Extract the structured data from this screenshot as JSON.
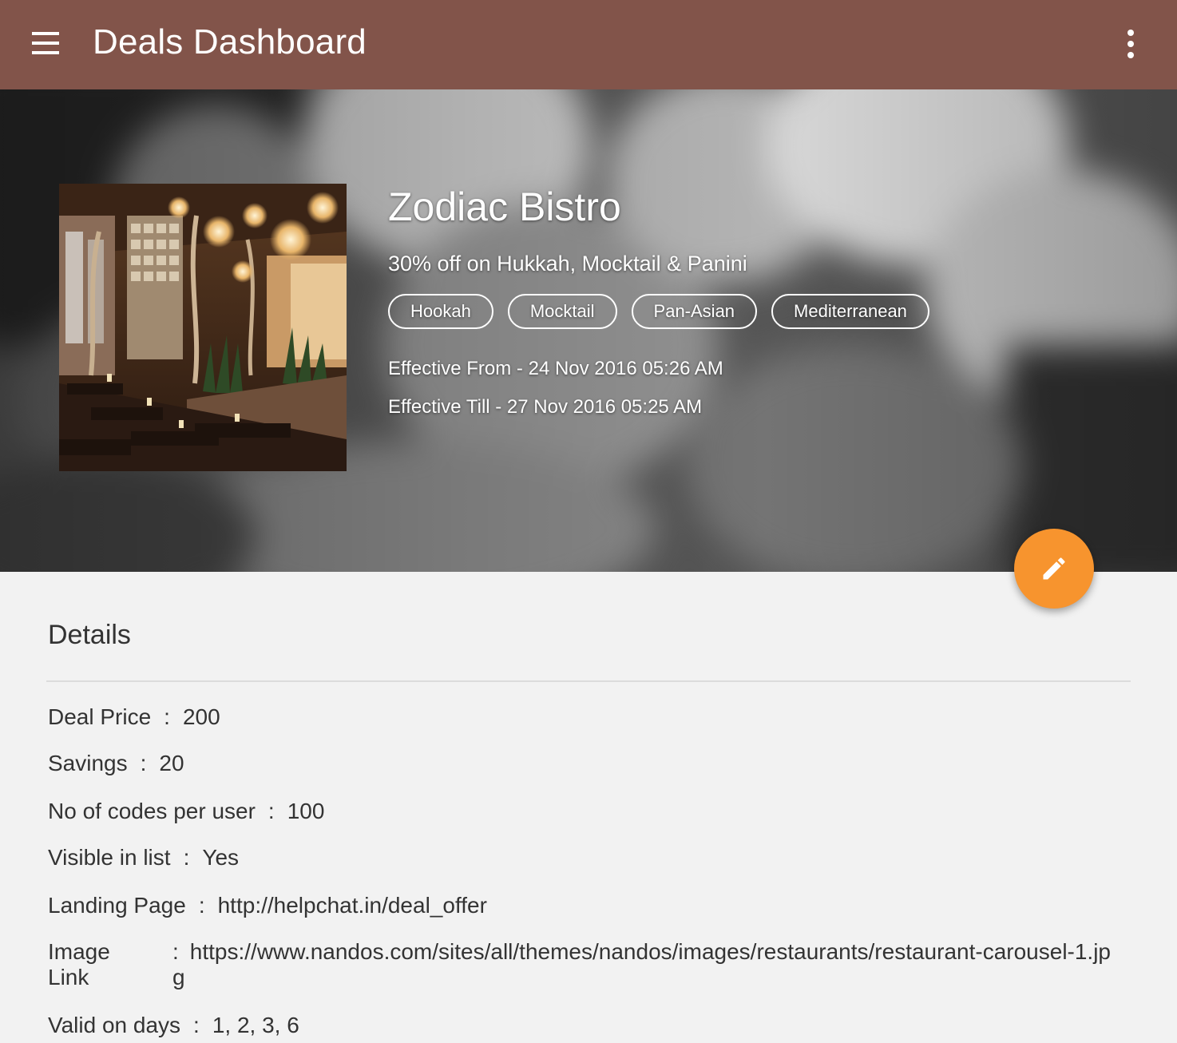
{
  "app": {
    "title": "Deals Dashboard",
    "bar_color": "#82544a"
  },
  "icons": {
    "menu": "menu-icon",
    "more": "more-vert-icon",
    "edit": "pencil-icon"
  },
  "deal": {
    "name": "Zodiac Bistro",
    "offer": "30% off on Hukkah, Mocktail & Panini",
    "tags": [
      "Hookah",
      "Mocktail",
      "Pan-Asian",
      "Mediterranean"
    ],
    "effective_from": "Effective From - 24 Nov 2016 05:26 AM",
    "effective_till": "Effective Till - 27 Nov 2016 05:25 AM"
  },
  "fab_color": "#f7942e",
  "details": {
    "title": "Details",
    "rows": [
      {
        "label": "Deal Price",
        "value": "200"
      },
      {
        "label": "Savings",
        "value": "20"
      },
      {
        "label": "No of codes per user",
        "value": "100"
      },
      {
        "label": "Visible in list",
        "value": "Yes"
      },
      {
        "label": "Landing Page",
        "value": "http://helpchat.in/deal_offer"
      }
    ],
    "image_link": {
      "label": "Image Link",
      "value": "https://www.nandos.com/sites/all/themes/nandos/images/restaurants/restaurant-carousel-1.jpg"
    },
    "valid_days": {
      "label": "Valid on days",
      "value": "1, 2, 3, 6"
    }
  }
}
